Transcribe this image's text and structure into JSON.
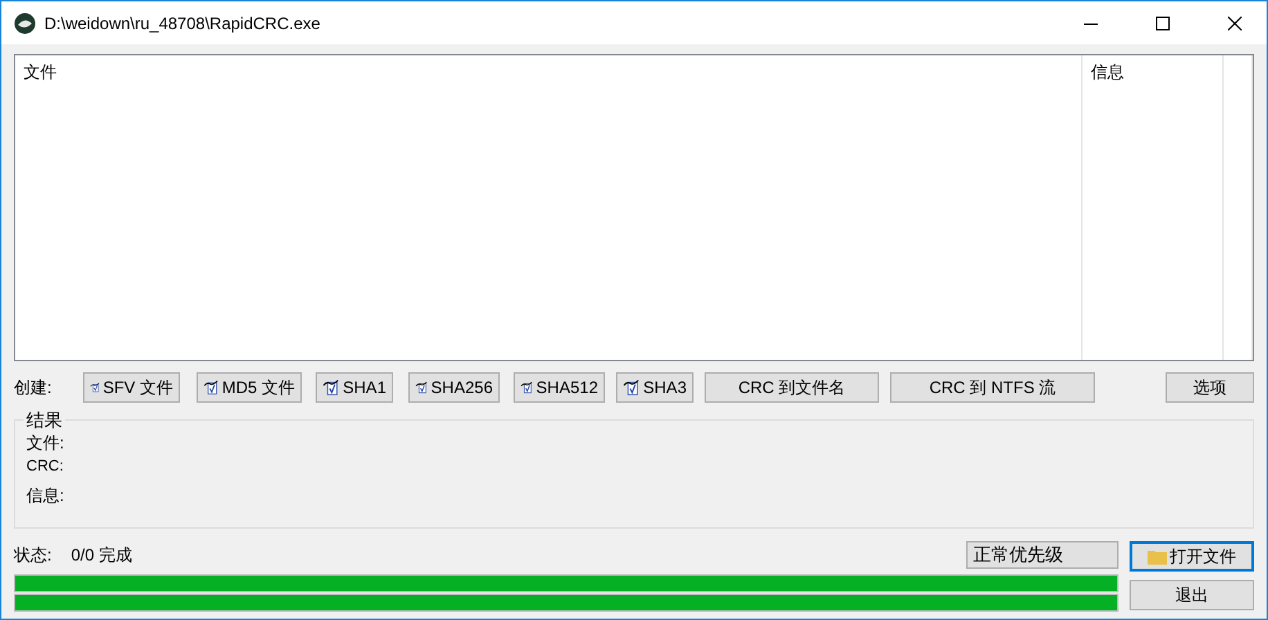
{
  "window": {
    "title": "D:\\weidown\\ru_48708\\RapidCRC.exe"
  },
  "file_list": {
    "columns": [
      "文件",
      "信息"
    ]
  },
  "create": {
    "label": "创建:",
    "buttons": [
      {
        "label": "SFV 文件",
        "kind": "hash"
      },
      {
        "label": "MD5 文件",
        "kind": "hash"
      },
      {
        "label": "SHA1",
        "kind": "hash"
      },
      {
        "label": "SHA256",
        "kind": "hash"
      },
      {
        "label": "SHA512",
        "kind": "hash"
      },
      {
        "label": "SHA3",
        "kind": "hash"
      },
      {
        "label": "CRC 到文件名",
        "kind": "plain"
      },
      {
        "label": "CRC 到 NTFS 流",
        "kind": "plain"
      }
    ],
    "options_button": "选项"
  },
  "results": {
    "title": "结果",
    "fields": [
      "文件:",
      "CRC:",
      "信息:"
    ]
  },
  "status": {
    "label": "状态:",
    "value": "0/0 完成"
  },
  "priority": {
    "value": "正常优先级"
  },
  "open_button": {
    "label": "打开文件",
    "focused": true
  },
  "exit_button": {
    "label": "退出",
    "focused": false
  },
  "progress": [
    {
      "level": 1
    },
    {
      "level": 1
    }
  ]
}
